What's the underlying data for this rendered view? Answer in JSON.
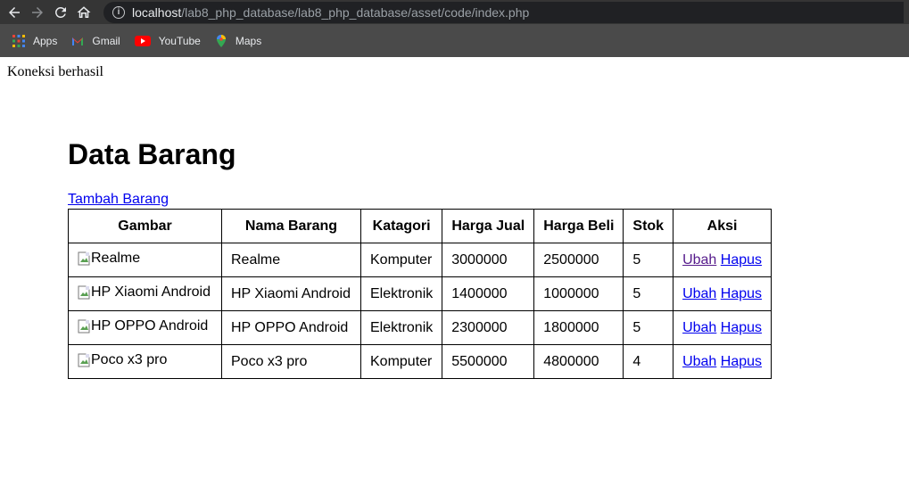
{
  "browser": {
    "url_host": "localhost",
    "url_path": "/lab8_php_database/lab8_php_database/asset/code/index.php",
    "bookmarks": [
      {
        "label": "Apps",
        "icon": "apps-grid-icon"
      },
      {
        "label": "Gmail",
        "icon": "gmail-icon"
      },
      {
        "label": "YouTube",
        "icon": "youtube-icon"
      },
      {
        "label": "Maps",
        "icon": "maps-icon"
      }
    ]
  },
  "page": {
    "connection_status": "Koneksi berhasil",
    "title": "Data Barang",
    "add_link": "Tambah Barang"
  },
  "table": {
    "headers": [
      "Gambar",
      "Nama Barang",
      "Katagori",
      "Harga Jual",
      "Harga Beli",
      "Stok",
      "Aksi"
    ],
    "rows": [
      {
        "gambar_alt": "Realme",
        "nama": "Realme",
        "kategori": "Komputer",
        "harga_jual": "3000000",
        "harga_beli": "2500000",
        "stok": "5",
        "ubah": "Ubah",
        "hapus": "Hapus"
      },
      {
        "gambar_alt": "HP Xiaomi Android",
        "nama": "HP Xiaomi Android",
        "kategori": "Elektronik",
        "harga_jual": "1400000",
        "harga_beli": "1000000",
        "stok": "5",
        "ubah": "Ubah",
        "hapus": "Hapus"
      },
      {
        "gambar_alt": "HP OPPO Android",
        "nama": "HP OPPO Android",
        "kategori": "Elektronik",
        "harga_jual": "2300000",
        "harga_beli": "1800000",
        "stok": "5",
        "ubah": "Ubah",
        "hapus": "Hapus"
      },
      {
        "gambar_alt": "Poco x3 pro",
        "nama": "Poco x3 pro",
        "kategori": "Komputer",
        "harga_jual": "5500000",
        "harga_beli": "4800000",
        "stok": "4",
        "ubah": "Ubah",
        "hapus": "Hapus"
      }
    ]
  },
  "colors": {
    "link": "#0000ee",
    "visited_link": "#551a8b",
    "chrome_bg": "#3c3c3c"
  }
}
